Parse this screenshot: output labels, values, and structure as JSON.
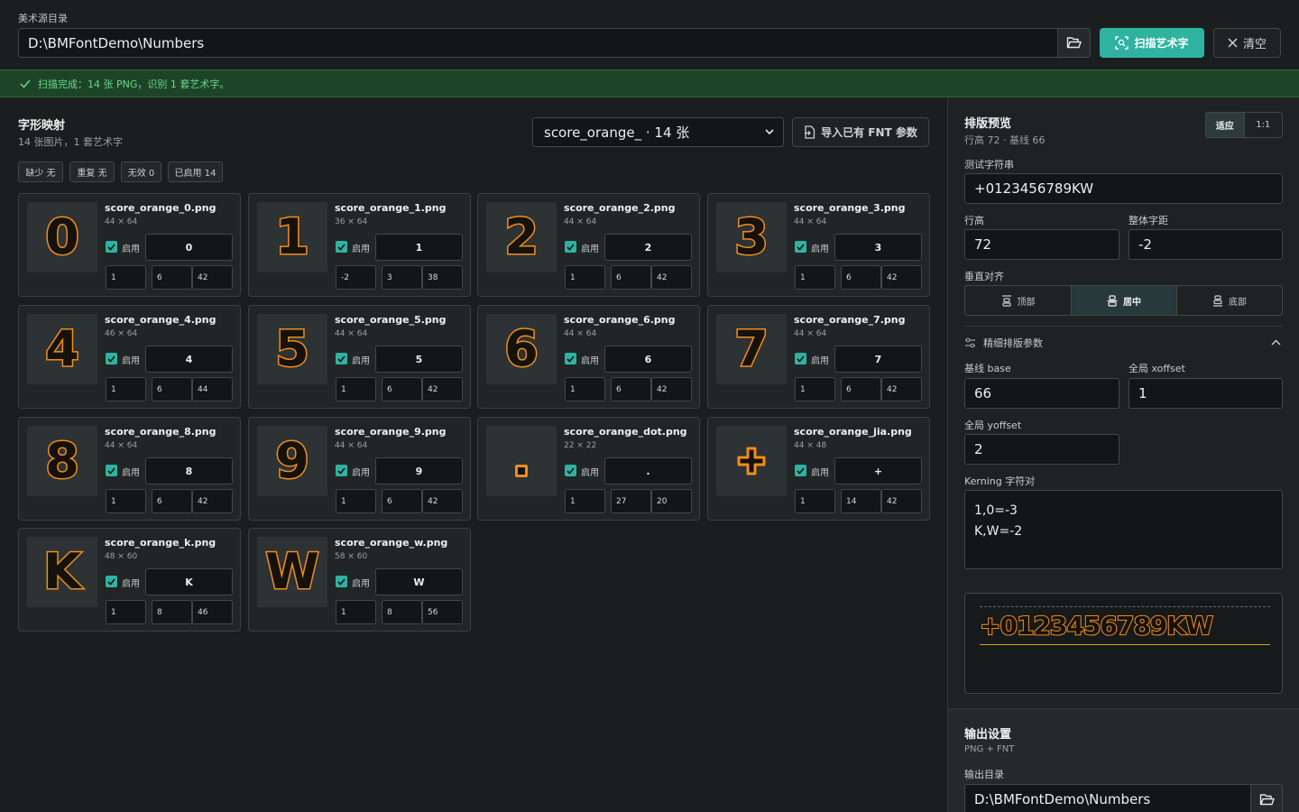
{
  "top": {
    "dir_label": "美术源目录",
    "dir_value": "D:\\BMFontDemo\\Numbers",
    "scan_label": "扫描艺术字",
    "clear_label": "清空"
  },
  "status": {
    "text": "扫描完成：14 张 PNG，识别 1 套艺术字。"
  },
  "left": {
    "title": "字形映射",
    "subtitle": "14 张图片，1 套艺术字",
    "select_value": "score_orange_ · 14 张",
    "import_label": "导入已有 FNT 参数",
    "chips": [
      "缺少 无",
      "重复 无",
      "无效 0",
      "已启用 14"
    ],
    "enable_label": "启用"
  },
  "glyphs": [
    {
      "file": "score_orange_0.png",
      "size": "44 × 64",
      "char": "0",
      "glyph": "0",
      "x": "1",
      "y": "6",
      "adv": "42"
    },
    {
      "file": "score_orange_1.png",
      "size": "36 × 64",
      "char": "1",
      "glyph": "1",
      "x": "-2",
      "y": "3",
      "adv": "38"
    },
    {
      "file": "score_orange_2.png",
      "size": "44 × 64",
      "char": "2",
      "glyph": "2",
      "x": "1",
      "y": "6",
      "adv": "42"
    },
    {
      "file": "score_orange_3.png",
      "size": "44 × 64",
      "char": "3",
      "glyph": "3",
      "x": "1",
      "y": "6",
      "adv": "42"
    },
    {
      "file": "score_orange_4.png",
      "size": "46 × 64",
      "char": "4",
      "glyph": "4",
      "x": "1",
      "y": "6",
      "adv": "44"
    },
    {
      "file": "score_orange_5.png",
      "size": "44 × 64",
      "char": "5",
      "glyph": "5",
      "x": "1",
      "y": "6",
      "adv": "42"
    },
    {
      "file": "score_orange_6.png",
      "size": "44 × 64",
      "char": "6",
      "glyph": "6",
      "x": "1",
      "y": "6",
      "adv": "42"
    },
    {
      "file": "score_orange_7.png",
      "size": "44 × 64",
      "char": "7",
      "glyph": "7",
      "x": "1",
      "y": "6",
      "adv": "42"
    },
    {
      "file": "score_orange_8.png",
      "size": "44 × 64",
      "char": "8",
      "glyph": "8",
      "x": "1",
      "y": "6",
      "adv": "42"
    },
    {
      "file": "score_orange_9.png",
      "size": "44 × 64",
      "char": "9",
      "glyph": "9",
      "x": "1",
      "y": "6",
      "adv": "42"
    },
    {
      "file": "score_orange_dot.png",
      "size": "22 × 22",
      "char": ".",
      "glyph": ".",
      "x": "1",
      "y": "27",
      "adv": "20"
    },
    {
      "file": "score_orange_jia.png",
      "size": "44 × 48",
      "char": "+",
      "glyph": "+",
      "x": "1",
      "y": "14",
      "adv": "42"
    },
    {
      "file": "score_orange_k.png",
      "size": "48 × 60",
      "char": "K",
      "glyph": "K",
      "x": "1",
      "y": "8",
      "adv": "46"
    },
    {
      "file": "score_orange_w.png",
      "size": "58 × 60",
      "char": "W",
      "glyph": "W",
      "x": "1",
      "y": "8",
      "adv": "56"
    }
  ],
  "right": {
    "title": "排版预览",
    "subtitle": "行高 72 · 基线 66",
    "toggle": [
      "适应",
      "1:1"
    ],
    "test_label": "测试字符串",
    "test_value": "+0123456789KW",
    "line_label": "行高",
    "line_value": "72",
    "spacing_label": "整体字距",
    "spacing_value": "-2",
    "valign_label": "垂直对齐",
    "valign": [
      "顶部",
      "居中",
      "底部"
    ],
    "fine_label": "精细排版参数",
    "base_label": "基线 base",
    "base_value": "66",
    "xoff_label": "全局 xoffset",
    "xoff_value": "1",
    "yoff_label": "全局 yoffset",
    "yoff_value": "2",
    "kern_label": "Kerning 字符对",
    "kern_value": "1,0=-3\nK,W=-2",
    "preview_text": "+0123456789KW"
  },
  "output": {
    "title": "输出设置",
    "subtitle": "PNG + FNT",
    "dir_label": "输出目录",
    "dir_value": "D:\\BMFontDemo\\Numbers"
  },
  "colors": {
    "accent": "#2fb3a1",
    "glyph_orange": "#f08c1e",
    "status_bg": "#1d4429"
  }
}
